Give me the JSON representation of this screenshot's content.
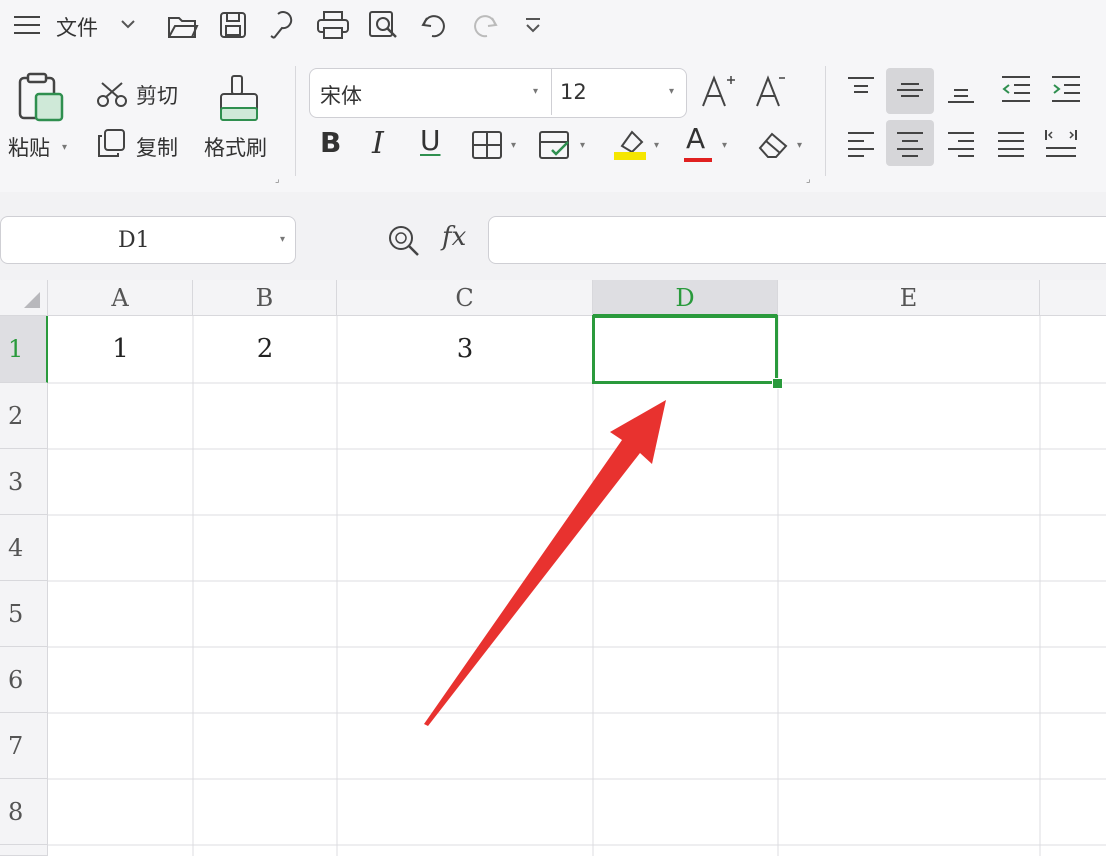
{
  "toolbar": {
    "menu_label": "文件",
    "icons": [
      "menu-icon",
      "folder-open-icon",
      "save-icon",
      "export-icon",
      "print-icon",
      "print-preview-icon",
      "undo-icon",
      "redo-icon",
      "customize-icon"
    ]
  },
  "ribbon": {
    "paste_label": "粘贴",
    "cut_label": "剪切",
    "copy_label": "复制",
    "format_painter_label": "格式刷",
    "font_name": "宋体",
    "font_size": "12",
    "bold_label": "B",
    "italic_label": "I",
    "underline_label": "U",
    "font_color_label": "A",
    "font_color": "#e02020",
    "highlight_color": "#f5e600"
  },
  "formula_bar": {
    "name_box": "D1",
    "fx_label": "fx",
    "formula_value": ""
  },
  "grid": {
    "columns": [
      "A",
      "B",
      "C",
      "D",
      "E"
    ],
    "rows": [
      "1",
      "2",
      "3",
      "4",
      "5",
      "6",
      "7",
      "8"
    ],
    "selected_cell": "D1",
    "selection_color": "#2a9a3c",
    "cells": {
      "A1": "1",
      "B1": "2",
      "C1": "3"
    }
  },
  "annotation": {
    "arrow_color": "#e8322f"
  }
}
